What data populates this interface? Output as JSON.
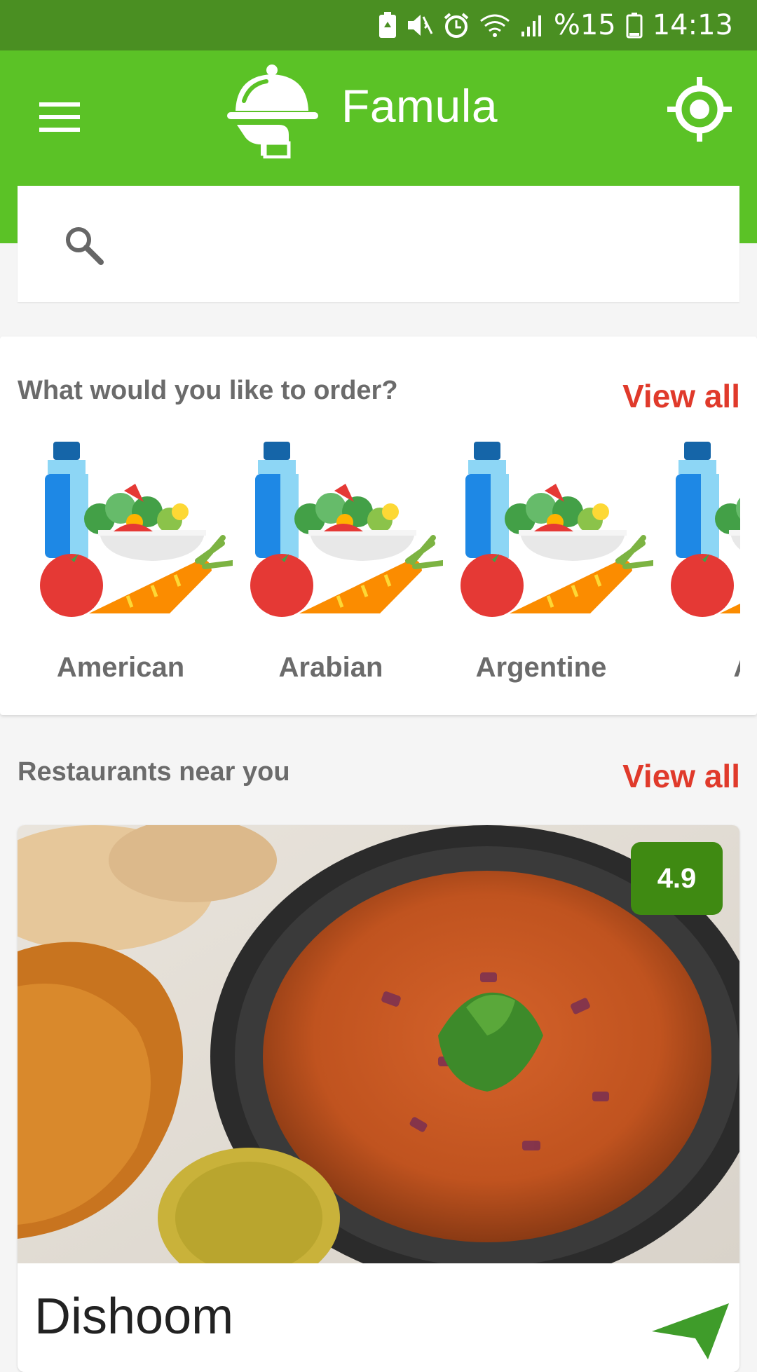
{
  "status_bar": {
    "battery_percent": "%15",
    "time": "14:13",
    "icons": [
      "battery-saver-icon",
      "mute-icon",
      "alarm-icon",
      "wifi-icon",
      "signal-icon",
      "battery-icon"
    ]
  },
  "app_bar": {
    "title": "Famula",
    "menu_icon": "hamburger-menu-icon",
    "logo_icon": "cloche-serving-hand-icon",
    "action_icon": "gps-locate-icon"
  },
  "search": {
    "placeholder": "",
    "value": "",
    "icon": "search-icon"
  },
  "categories_section": {
    "title": "What would you like to order?",
    "view_all_label": "View all",
    "items": [
      {
        "label": "American",
        "icon": "healthy-food-icon"
      },
      {
        "label": "Arabian",
        "icon": "healthy-food-icon"
      },
      {
        "label": "Argentine",
        "icon": "healthy-food-icon"
      },
      {
        "label": "As",
        "icon": "healthy-food-icon"
      }
    ]
  },
  "restaurants_section": {
    "title": "Restaurants near you",
    "view_all_label": "View all",
    "restaurants": [
      {
        "name": "Dishoom",
        "rating": "4.9",
        "photo": "pav-bhaji-photo",
        "action_icon": "navigate-arrow-icon"
      }
    ]
  },
  "colors": {
    "status_bar": "#4a8f22",
    "app_bar": "#5bc226",
    "view_all": "#e03a2b",
    "rating_badge": "#3f8a12",
    "section_text": "#6b6b6b"
  }
}
